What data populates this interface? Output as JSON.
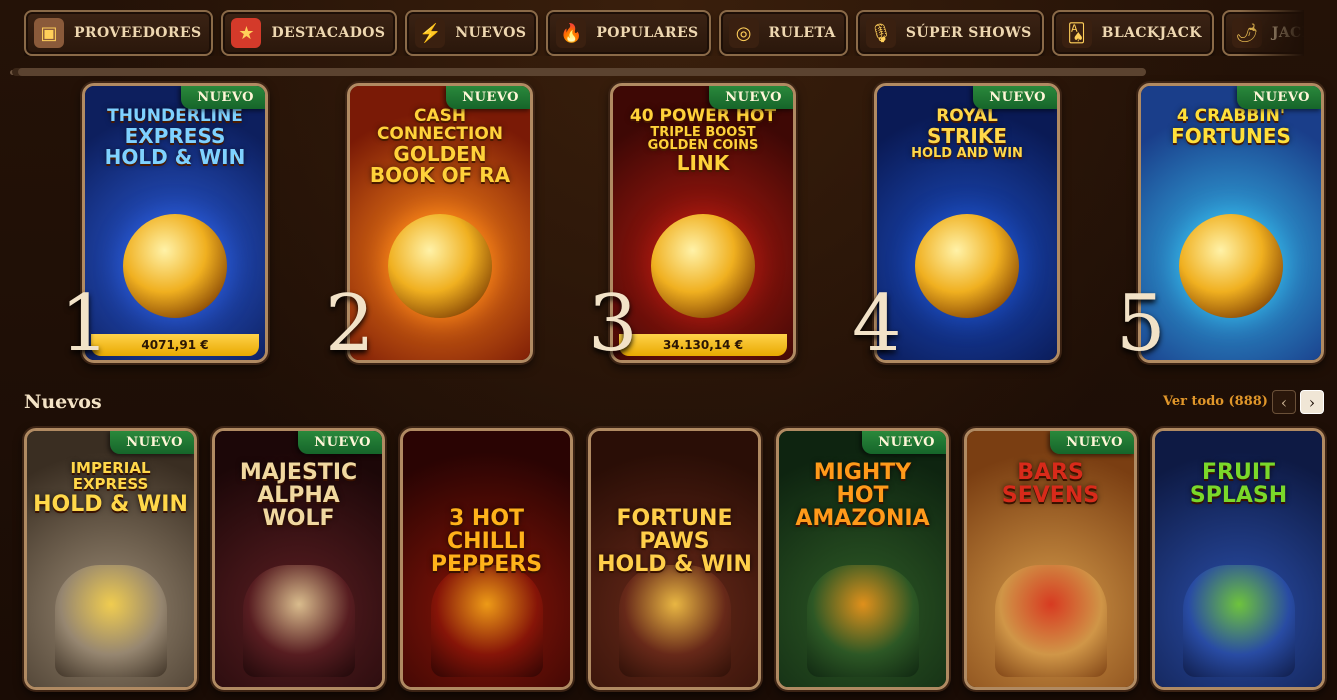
{
  "tabs": [
    {
      "label": "PROVEEDORES",
      "icon": "book-icon",
      "color": "#8a5a3a",
      "glyph": "▣"
    },
    {
      "label": "DESTACADOS",
      "icon": "star-icon",
      "color": "#d43a2a",
      "glyph": "★"
    },
    {
      "label": "NUEVOS",
      "icon": "lightning-icon",
      "color": "#3a2010",
      "glyph": "⚡"
    },
    {
      "label": "POPULARES",
      "icon": "flame-icon",
      "color": "#3a2010",
      "glyph": "🔥"
    },
    {
      "label": "RULETA",
      "icon": "roulette-icon",
      "color": "#3a2010",
      "glyph": "◎"
    },
    {
      "label": "SÚPER SHOWS",
      "icon": "microphone-icon",
      "color": "#3a2010",
      "glyph": "🎙"
    },
    {
      "label": "BLACKJACK",
      "icon": "cards-icon",
      "color": "#3a2010",
      "glyph": "🂡"
    },
    {
      "label": "JACKPOTS CALI",
      "icon": "chili-icon",
      "color": "#3a2010",
      "glyph": "🌶"
    }
  ],
  "badge_label": "NUEVO",
  "top_games": [
    {
      "rank": "1",
      "title_lines": [
        "THUNDERLINE",
        "EXPRESS",
        "HOLD & WIN"
      ],
      "jackpot": "4071,91 €",
      "bg": [
        "#2a5bd8",
        "#0d1f5e"
      ],
      "title_color": "#7fd2ff",
      "new": true
    },
    {
      "rank": "2",
      "title_lines": [
        "CASH CONNECTION",
        "GOLDEN",
        "BOOK OF RA"
      ],
      "jackpot": "",
      "bg": [
        "#ff8a1a",
        "#7a1a06"
      ],
      "title_color": "#ffd23a",
      "new": true
    },
    {
      "rank": "3",
      "title_lines": [
        "40 POWER HOT",
        "Triple BOOST",
        "GOLDEN COINS",
        "LINK"
      ],
      "jackpot": "34.130,14 €",
      "bg": [
        "#b01a10",
        "#3e0805"
      ],
      "title_color": "#ffd23a",
      "new": true
    },
    {
      "rank": "4",
      "title_lines": [
        "ROYAL",
        "STRIKE",
        "HOLD AND WIN"
      ],
      "jackpot": "",
      "bg": [
        "#1d4fc4",
        "#0a1a55"
      ],
      "title_color": "#ffd84a",
      "new": true
    },
    {
      "rank": "5",
      "title_lines": [
        "4 CRABBIN'",
        "FORTUNES"
      ],
      "jackpot": "",
      "bg": [
        "#35b6e8",
        "#1a3e8a"
      ],
      "title_color": "#ffe03a",
      "new": true
    }
  ],
  "section": {
    "title": "Nuevos",
    "see_all": "Ver todo (888)",
    "prev": "‹",
    "next": "›"
  },
  "new_games": [
    {
      "title_lines": [
        "IMPERIAL EXPRESS",
        "HOLD & WIN"
      ],
      "bg": [
        "#9a8a74",
        "#3a2e22"
      ],
      "title_color": "#ffd84a",
      "new": true
    },
    {
      "title_lines": [
        "MAJESTIC",
        "ALPHA WOLF"
      ],
      "bg": [
        "#5a1e22",
        "#1c0708"
      ],
      "title_color": "#f0d8a0",
      "new": true
    },
    {
      "title_lines": [
        "3 HOT",
        "CHILLI",
        "PEPPERS"
      ],
      "bg": [
        "#8a1508",
        "#2a0403"
      ],
      "title_color": "#ffb21a",
      "new": false
    },
    {
      "title_lines": [
        "FORTUNE",
        "PAWS",
        "HOLD & WIN"
      ],
      "bg": [
        "#6a2a1a",
        "#2a0e06"
      ],
      "title_color": "#ffcf4a",
      "new": false
    },
    {
      "title_lines": [
        "MIGHTY HOT",
        "AMAZONIA"
      ],
      "bg": [
        "#2e5a26",
        "#0e2410"
      ],
      "title_color": "#ff9a1a",
      "new": true
    },
    {
      "title_lines": [
        "BARS",
        "Sevens"
      ],
      "bg": [
        "#d49a4a",
        "#7a3e12"
      ],
      "title_color": "#d82a1a",
      "new": true
    },
    {
      "title_lines": [
        "FRUIT",
        "SPLASH"
      ],
      "bg": [
        "#2a4ea8",
        "#0e1a44"
      ],
      "title_color": "#7ad82a",
      "new": false
    }
  ]
}
